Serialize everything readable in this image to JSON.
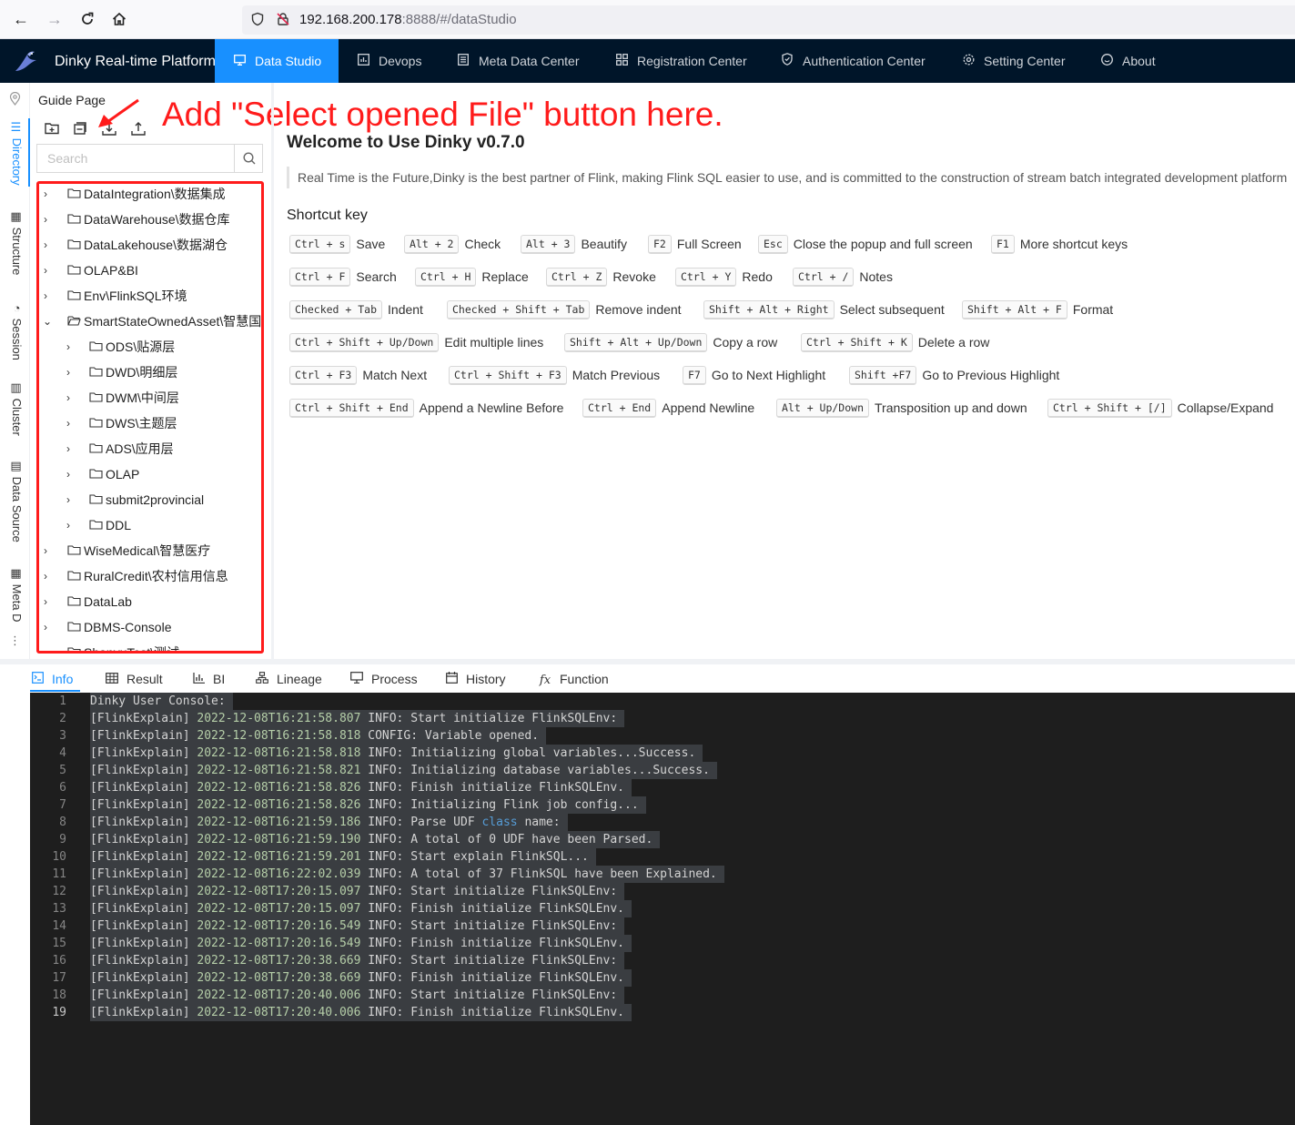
{
  "browser": {
    "url_host": "192.168.200.178",
    "url_rest": ":8888/#/dataStudio"
  },
  "header": {
    "title": "Dinky Real-time Platform",
    "menu": [
      {
        "label": "Data Studio",
        "icon": "monitor-icon",
        "active": true
      },
      {
        "label": "Devops",
        "icon": "chart-icon"
      },
      {
        "label": "Meta Data Center",
        "icon": "list-icon"
      },
      {
        "label": "Registration Center",
        "icon": "grid-icon"
      },
      {
        "label": "Authentication Center",
        "icon": "shield-icon"
      },
      {
        "label": "Setting Center",
        "icon": "gear-icon"
      },
      {
        "label": "About",
        "icon": "smile-icon"
      }
    ]
  },
  "left_tabs": [
    {
      "label": "Directory",
      "active": true
    },
    {
      "label": "Structure"
    },
    {
      "label": "Session"
    },
    {
      "label": "Cluster"
    },
    {
      "label": "Data Source"
    },
    {
      "label": "Meta D"
    }
  ],
  "sidebar": {
    "guide_page": "Guide Page",
    "search_placeholder": "Search",
    "tree": [
      {
        "label": "DataIntegration\\数据集成",
        "level": 0,
        "expanded": false
      },
      {
        "label": "DataWarehouse\\数据仓库",
        "level": 0,
        "expanded": false
      },
      {
        "label": "DataLakehouse\\数据湖仓",
        "level": 0,
        "expanded": false
      },
      {
        "label": "OLAP&BI",
        "level": 0,
        "expanded": false
      },
      {
        "label": "Env\\FlinkSQL环境",
        "level": 0,
        "expanded": false
      },
      {
        "label": "SmartStateOwnedAsset\\智慧国资",
        "level": 0,
        "expanded": true
      },
      {
        "label": "ODS\\贴源层",
        "level": 1,
        "expanded": false
      },
      {
        "label": "DWD\\明细层",
        "level": 1,
        "expanded": false
      },
      {
        "label": "DWM\\中间层",
        "level": 1,
        "expanded": false
      },
      {
        "label": "DWS\\主题层",
        "level": 1,
        "expanded": false
      },
      {
        "label": "ADS\\应用层",
        "level": 1,
        "expanded": false
      },
      {
        "label": "OLAP",
        "level": 1,
        "expanded": false
      },
      {
        "label": "submit2provincial",
        "level": 1,
        "expanded": false
      },
      {
        "label": "DDL",
        "level": 1,
        "expanded": false
      },
      {
        "label": "WiseMedical\\智慧医疗",
        "level": 0,
        "expanded": false
      },
      {
        "label": "RuralCredit\\农村信用信息",
        "level": 0,
        "expanded": false
      },
      {
        "label": "DataLab",
        "level": 0,
        "expanded": false
      },
      {
        "label": "DBMS-Console",
        "level": 0,
        "expanded": false
      },
      {
        "label": "ShanyuTest\\测试",
        "level": 0,
        "expanded": false
      }
    ]
  },
  "annotation": "Add \"Select opened File\" button here.",
  "welcome": {
    "title": "Welcome to Use Dinky v0.7.0",
    "intro": "Real Time is the Future,Dinky is the best partner of Flink, making Flink SQL easier to use, and is committed to the construction of stream batch integrated development platform",
    "shortcut_heading": "Shortcut key",
    "shortcuts": [
      [
        {
          "key": "Ctrl + s",
          "desc": "Save"
        },
        {
          "key": "Alt + 2",
          "desc": "Check"
        },
        {
          "key": "Alt + 3",
          "desc": "Beautify"
        },
        {
          "key": "F2",
          "desc": "Full Screen"
        },
        {
          "key": "Esc",
          "desc": "Close the popup and full screen"
        },
        {
          "key": "F1",
          "desc": "More shortcut keys"
        }
      ],
      [
        {
          "key": "Ctrl + F",
          "desc": "Search"
        },
        {
          "key": "Ctrl + H",
          "desc": "Replace"
        },
        {
          "key": "Ctrl + Z",
          "desc": "Revoke"
        },
        {
          "key": "Ctrl + Y",
          "desc": "Redo"
        },
        {
          "key": "Ctrl + /",
          "desc": "Notes"
        }
      ],
      [
        {
          "key": "Checked + Tab",
          "desc": "Indent"
        },
        {
          "key": "Checked + Shift + Tab",
          "desc": "Remove indent"
        },
        {
          "key": "Shift + Alt + Right",
          "desc": "Select subsequent"
        },
        {
          "key": "Shift + Alt + F",
          "desc": "Format"
        }
      ],
      [
        {
          "key": "Ctrl + Shift + Up/Down",
          "desc": "Edit multiple lines"
        },
        {
          "key": "Shift + Alt + Up/Down",
          "desc": "Copy a row"
        },
        {
          "key": "Ctrl + Shift + K",
          "desc": "Delete a row"
        }
      ],
      [
        {
          "key": "Ctrl + F3",
          "desc": "Match Next"
        },
        {
          "key": "Ctrl + Shift + F3",
          "desc": "Match Previous"
        },
        {
          "key": "F7",
          "desc": "Go to Next Highlight"
        },
        {
          "key": "Shift +F7",
          "desc": "Go to Previous Highlight"
        }
      ],
      [
        {
          "key": "Ctrl + Shift + End",
          "desc": "Append a Newline Before"
        },
        {
          "key": "Ctrl + End",
          "desc": "Append Newline"
        },
        {
          "key": "Alt + Up/Down",
          "desc": "Transposition up and down"
        },
        {
          "key": "Ctrl + Shift + [/]",
          "desc": "Collapse/Expand"
        }
      ]
    ]
  },
  "bottom_tabs": [
    {
      "label": "Info",
      "icon": "console-icon",
      "active": true
    },
    {
      "label": "Result",
      "icon": "table-icon"
    },
    {
      "label": "BI",
      "icon": "bar-chart-icon"
    },
    {
      "label": "Lineage",
      "icon": "lineage-icon"
    },
    {
      "label": "Process",
      "icon": "desktop-icon"
    },
    {
      "label": "History",
      "icon": "calendar-icon"
    },
    {
      "label": "Function",
      "icon": "function-icon"
    }
  ],
  "console": {
    "lines": [
      {
        "num": "1",
        "prefix": "Dinky User Console:",
        "time": "",
        "msg": ""
      },
      {
        "num": "2",
        "prefix": "[FlinkExplain] ",
        "time": "2022-12-08T16:21:58.807",
        "msg": " INFO: Start initialize FlinkSQLEnv:"
      },
      {
        "num": "3",
        "prefix": "[FlinkExplain] ",
        "time": "2022-12-08T16:21:58.818",
        "msg": " CONFIG: Variable opened."
      },
      {
        "num": "4",
        "prefix": "[FlinkExplain] ",
        "time": "2022-12-08T16:21:58.818",
        "msg": " INFO: Initializing global variables...Success."
      },
      {
        "num": "5",
        "prefix": "[FlinkExplain] ",
        "time": "2022-12-08T16:21:58.821",
        "msg": " INFO: Initializing database variables...Success."
      },
      {
        "num": "6",
        "prefix": "[FlinkExplain] ",
        "time": "2022-12-08T16:21:58.826",
        "msg": " INFO: Finish initialize FlinkSQLEnv."
      },
      {
        "num": "7",
        "prefix": "[FlinkExplain] ",
        "time": "2022-12-08T16:21:58.826",
        "msg": " INFO: Initializing Flink job config..."
      },
      {
        "num": "8",
        "prefix": "[FlinkExplain] ",
        "time": "2022-12-08T16:21:59.186",
        "msg": " INFO: Parse UDF ",
        "kw": "class",
        "msg2": " name:"
      },
      {
        "num": "9",
        "prefix": "[FlinkExplain] ",
        "time": "2022-12-08T16:21:59.190",
        "msg": " INFO: A total of 0 UDF have been Parsed."
      },
      {
        "num": "10",
        "prefix": "[FlinkExplain] ",
        "time": "2022-12-08T16:21:59.201",
        "msg": " INFO: Start explain FlinkSQL..."
      },
      {
        "num": "11",
        "prefix": "[FlinkExplain] ",
        "time": "2022-12-08T16:22:02.039",
        "msg": " INFO: A total of 37 FlinkSQL have been Explained."
      },
      {
        "num": "12",
        "prefix": "[FlinkExplain] ",
        "time": "2022-12-08T17:20:15.097",
        "msg": " INFO: Start initialize FlinkSQLEnv:"
      },
      {
        "num": "13",
        "prefix": "[FlinkExplain] ",
        "time": "2022-12-08T17:20:15.097",
        "msg": " INFO: Finish initialize FlinkSQLEnv."
      },
      {
        "num": "14",
        "prefix": "[FlinkExplain] ",
        "time": "2022-12-08T17:20:16.549",
        "msg": " INFO: Start initialize FlinkSQLEnv:"
      },
      {
        "num": "15",
        "prefix": "[FlinkExplain] ",
        "time": "2022-12-08T17:20:16.549",
        "msg": " INFO: Finish initialize FlinkSQLEnv."
      },
      {
        "num": "16",
        "prefix": "[FlinkExplain] ",
        "time": "2022-12-08T17:20:38.669",
        "msg": " INFO: Start initialize FlinkSQLEnv:"
      },
      {
        "num": "17",
        "prefix": "[FlinkExplain] ",
        "time": "2022-12-08T17:20:38.669",
        "msg": " INFO: Finish initialize FlinkSQLEnv."
      },
      {
        "num": "18",
        "prefix": "[FlinkExplain] ",
        "time": "2022-12-08T17:20:40.006",
        "msg": " INFO: Start initialize FlinkSQLEnv:"
      },
      {
        "num": "19",
        "prefix": "[FlinkExplain] ",
        "time": "2022-12-08T17:20:40.006",
        "msg": " INFO: Finish initialize FlinkSQLEnv.",
        "current": true
      }
    ]
  },
  "colors": {
    "header_bg": "#001529",
    "accent": "#1890ff",
    "annotation": "#ff1b1b",
    "console_bg": "#1e1e1e"
  }
}
